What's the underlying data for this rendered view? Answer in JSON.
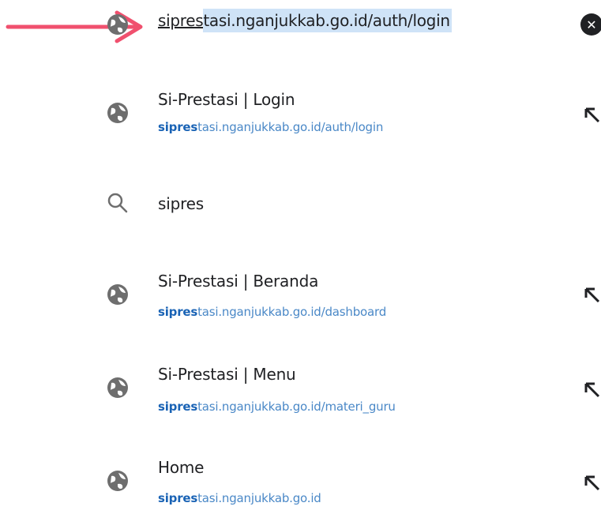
{
  "omnibox": {
    "typed": "sipres",
    "completion": "tasi.nganjukkab.go.id/auth/login"
  },
  "icons": {
    "annotation": "red-arrow-icon",
    "globe": "globe-icon",
    "search": "search-icon",
    "fill": "fill-arrow-icon",
    "clear": "clear-icon"
  },
  "colors": {
    "annotation": "#f0506e",
    "url": "#4a88c7",
    "url_match": "#1a63b5",
    "selection": "#cfe3f7"
  },
  "suggestions": [
    {
      "title": "Si-Prestasi | Login",
      "url_match": "sipres",
      "url_rest": "tasi.nganjukkab.go.id/auth/login"
    },
    {
      "query": "sipres"
    },
    {
      "title": "Si-Prestasi | Beranda",
      "url_match": "sipres",
      "url_rest": "tasi.nganjukkab.go.id/dashboard"
    },
    {
      "title": "Si-Prestasi | Menu",
      "url_match": "sipres",
      "url_rest": "tasi.nganjukkab.go.id/materi_guru"
    },
    {
      "title": "Home",
      "url_match": "sipres",
      "url_rest": "tasi.nganjukkab.go.id"
    }
  ]
}
